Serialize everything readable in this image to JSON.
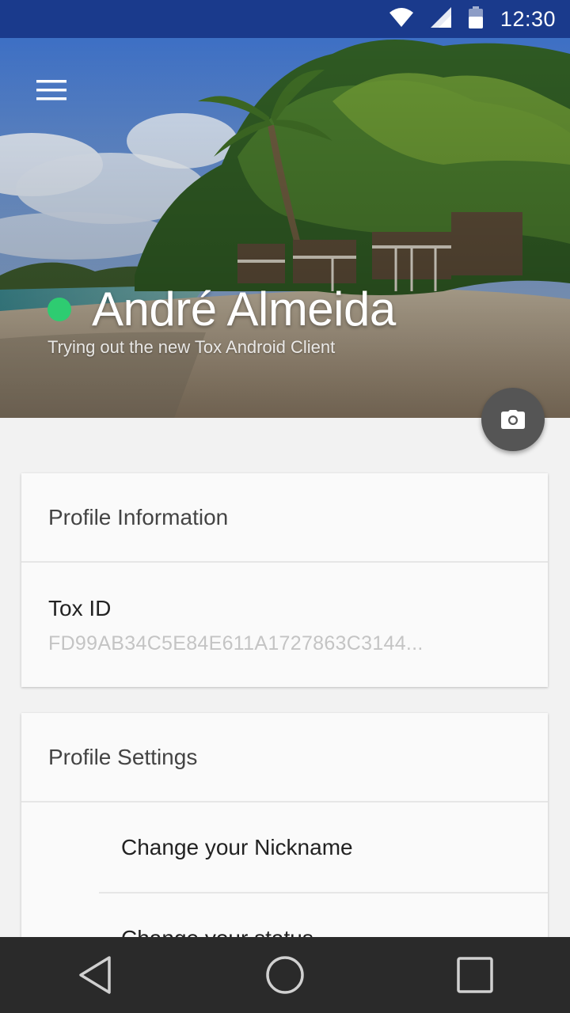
{
  "status_bar": {
    "time": "12:30",
    "icons": [
      "wifi-icon",
      "signal-icon",
      "battery-icon"
    ],
    "color": "#1a3a8c"
  },
  "header": {
    "menu_icon": "hamburger-menu-icon",
    "profile_name": "André Almeida",
    "profile_status": "Trying out the new Tox Android Client",
    "online_indicator_color": "#2ecc71",
    "camera_icon": "camera-icon"
  },
  "profile_info_card": {
    "title": "Profile Information",
    "tox_id_label": "Tox ID",
    "tox_id_value": "FD99AB34C5E84E611A1727863C3144..."
  },
  "profile_settings_card": {
    "title": "Profile Settings",
    "items": [
      {
        "label": "Change your Nickname"
      },
      {
        "label": "Change your status"
      }
    ]
  },
  "nav_bar": {
    "icons": [
      "back-icon",
      "home-icon",
      "recents-icon"
    ]
  }
}
